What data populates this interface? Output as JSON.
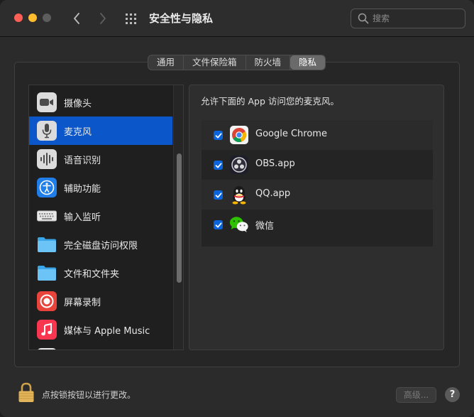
{
  "window": {
    "title": "安全性与隐私",
    "search_placeholder": "搜索"
  },
  "tabs": [
    {
      "label": "通用",
      "active": false
    },
    {
      "label": "文件保险箱",
      "active": false
    },
    {
      "label": "防火墙",
      "active": false
    },
    {
      "label": "隐私",
      "active": true
    }
  ],
  "sidebar": {
    "items": [
      {
        "label": "摄像头",
        "icon": "camera-icon"
      },
      {
        "label": "麦克风",
        "icon": "microphone-icon",
        "selected": true
      },
      {
        "label": "语音识别",
        "icon": "speech-recognition-icon"
      },
      {
        "label": "辅助功能",
        "icon": "accessibility-icon"
      },
      {
        "label": "输入监听",
        "icon": "keyboard-icon"
      },
      {
        "label": "完全磁盘访问权限",
        "icon": "folder-icon"
      },
      {
        "label": "文件和文件夹",
        "icon": "folder-icon"
      },
      {
        "label": "屏幕录制",
        "icon": "screen-recording-icon"
      },
      {
        "label": "媒体与 Apple Music",
        "icon": "music-icon"
      }
    ]
  },
  "content": {
    "description": "允许下面的 App 访问您的麦克风。",
    "apps": [
      {
        "name": "Google Chrome",
        "checked": true,
        "icon": "chrome-icon"
      },
      {
        "name": "OBS.app",
        "checked": true,
        "icon": "obs-icon"
      },
      {
        "name": "QQ.app",
        "checked": true,
        "icon": "qq-icon"
      },
      {
        "name": "微信",
        "checked": true,
        "icon": "wechat-icon"
      }
    ]
  },
  "footer": {
    "lock_text": "点按锁按钮以进行更改。",
    "advanced_label": "高级...",
    "help_label": "?"
  },
  "colors": {
    "selection": "#0b57c9",
    "checkbox": "#0a64dc"
  }
}
